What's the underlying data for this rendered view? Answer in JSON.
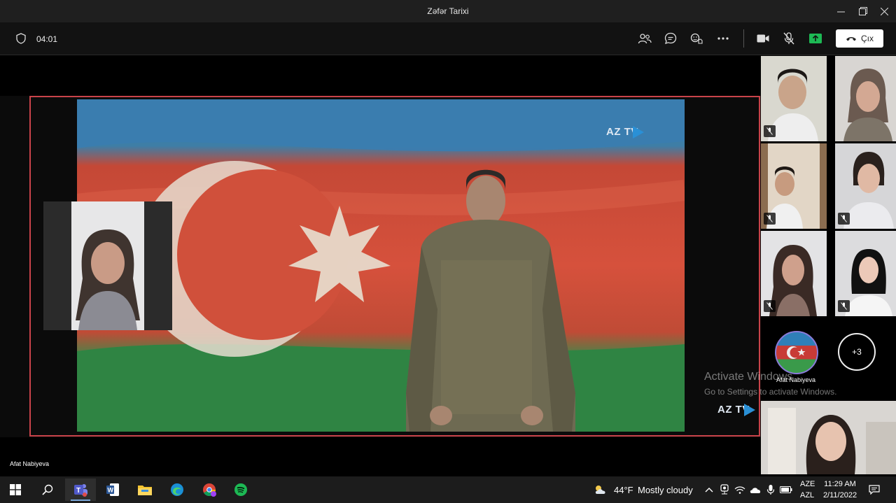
{
  "window": {
    "title": "Zəfər Tarixi"
  },
  "toolbar": {
    "timer": "04:01",
    "leave_label": "Çıx",
    "share_color": "#1db954",
    "leave_bg": "#ffffff"
  },
  "stage": {
    "shared_content": "video",
    "channel_logo": "AZ TV",
    "presenter_name": "Afat Nabiyeva",
    "frame_color": "#c9434a"
  },
  "watermark": {
    "line1": "Activate Windows",
    "line2": "Go to Settings to activate Windows."
  },
  "gallery": {
    "avatar_name": "Afat Nabiyeva",
    "more_count": "+3"
  },
  "taskbar": {
    "weather_temp": "44°F",
    "weather_desc": "Mostly cloudy",
    "lang_top": "AZE",
    "lang_bottom": "AZL",
    "time": "11:29 AM",
    "date": "2/11/2022"
  }
}
